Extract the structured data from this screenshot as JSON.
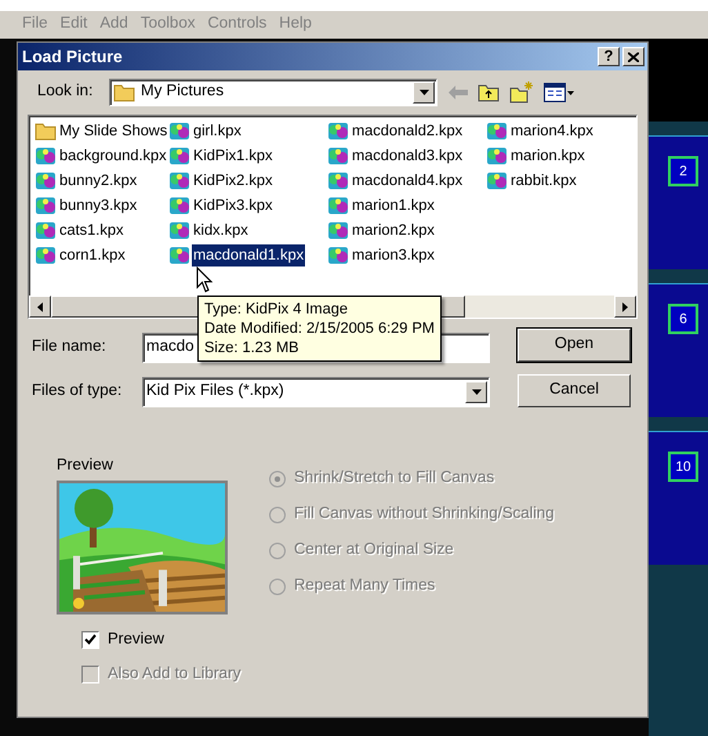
{
  "menu": [
    {
      "label": "File",
      "disabled": true
    },
    {
      "label": "Edit",
      "disabled": true
    },
    {
      "label": "Add",
      "disabled": true
    },
    {
      "label": "Toolbox",
      "disabled": true
    },
    {
      "label": "Controls",
      "disabled": true
    },
    {
      "label": "Help",
      "disabled": true
    }
  ],
  "dialog": {
    "title": "Load Picture",
    "help_button": "?",
    "look_in": {
      "label": "Look in:",
      "value": "My Pictures"
    },
    "files": [
      {
        "name": "My Slide Shows",
        "kind": "folder",
        "selected": false
      },
      {
        "name": "background.kpx",
        "kind": "kpx",
        "selected": false
      },
      {
        "name": "bunny2.kpx",
        "kind": "kpx",
        "selected": false
      },
      {
        "name": "bunny3.kpx",
        "kind": "kpx",
        "selected": false
      },
      {
        "name": "cats1.kpx",
        "kind": "kpx",
        "selected": false
      },
      {
        "name": "corn1.kpx",
        "kind": "kpx",
        "selected": false
      },
      {
        "name": "girl.kpx",
        "kind": "kpx",
        "selected": false
      },
      {
        "name": "KidPix1.kpx",
        "kind": "kpx",
        "selected": false
      },
      {
        "name": "KidPix2.kpx",
        "kind": "kpx",
        "selected": false
      },
      {
        "name": "KidPix3.kpx",
        "kind": "kpx",
        "selected": false
      },
      {
        "name": "kidx.kpx",
        "kind": "kpx",
        "selected": false
      },
      {
        "name": "macdonald1.kpx",
        "kind": "kpx",
        "selected": true
      },
      {
        "name": "macdonald2.kpx",
        "kind": "kpx",
        "selected": false
      },
      {
        "name": "macdonald3.kpx",
        "kind": "kpx",
        "selected": false
      },
      {
        "name": "macdonald4.kpx",
        "kind": "kpx",
        "selected": false
      },
      {
        "name": "marion1.kpx",
        "kind": "kpx",
        "selected": false
      },
      {
        "name": "marion2.kpx",
        "kind": "kpx",
        "selected": false
      },
      {
        "name": "marion3.kpx",
        "kind": "kpx",
        "selected": false
      },
      {
        "name": "marion4.kpx",
        "kind": "kpx",
        "selected": false
      },
      {
        "name": "marion.kpx",
        "kind": "kpx",
        "selected": false
      },
      {
        "name": "rabbit.kpx",
        "kind": "kpx",
        "selected": false
      }
    ],
    "tooltip": [
      "Type: KidPix 4 Image",
      "Date Modified: 2/15/2005 6:29 PM",
      "Size: 1.23 MB"
    ],
    "file_name": {
      "label": "File name:",
      "value": "macdo"
    },
    "files_of_type": {
      "label": "Files of type:",
      "value": "Kid Pix Files (*.kpx)"
    },
    "buttons": [
      "Open",
      "Cancel"
    ],
    "preview_label": "Preview",
    "preview_image": {
      "kind": "picture"
    },
    "options": [
      {
        "label": "Shrink/Stretch to Fill Canvas",
        "selected": true,
        "disabled": true
      },
      {
        "label": "Fill Canvas without Shrinking/Scaling",
        "selected": false,
        "disabled": true
      },
      {
        "label": "Center at Original Size",
        "selected": false,
        "disabled": true
      },
      {
        "label": "Repeat Many Times",
        "selected": false,
        "disabled": true
      }
    ],
    "checkboxes": [
      {
        "label": "Preview",
        "checked": true,
        "disabled": false
      },
      {
        "label": "Also Add to Library",
        "checked": false,
        "disabled": true
      }
    ]
  },
  "side_badges": [
    "2",
    "6",
    "10"
  ]
}
